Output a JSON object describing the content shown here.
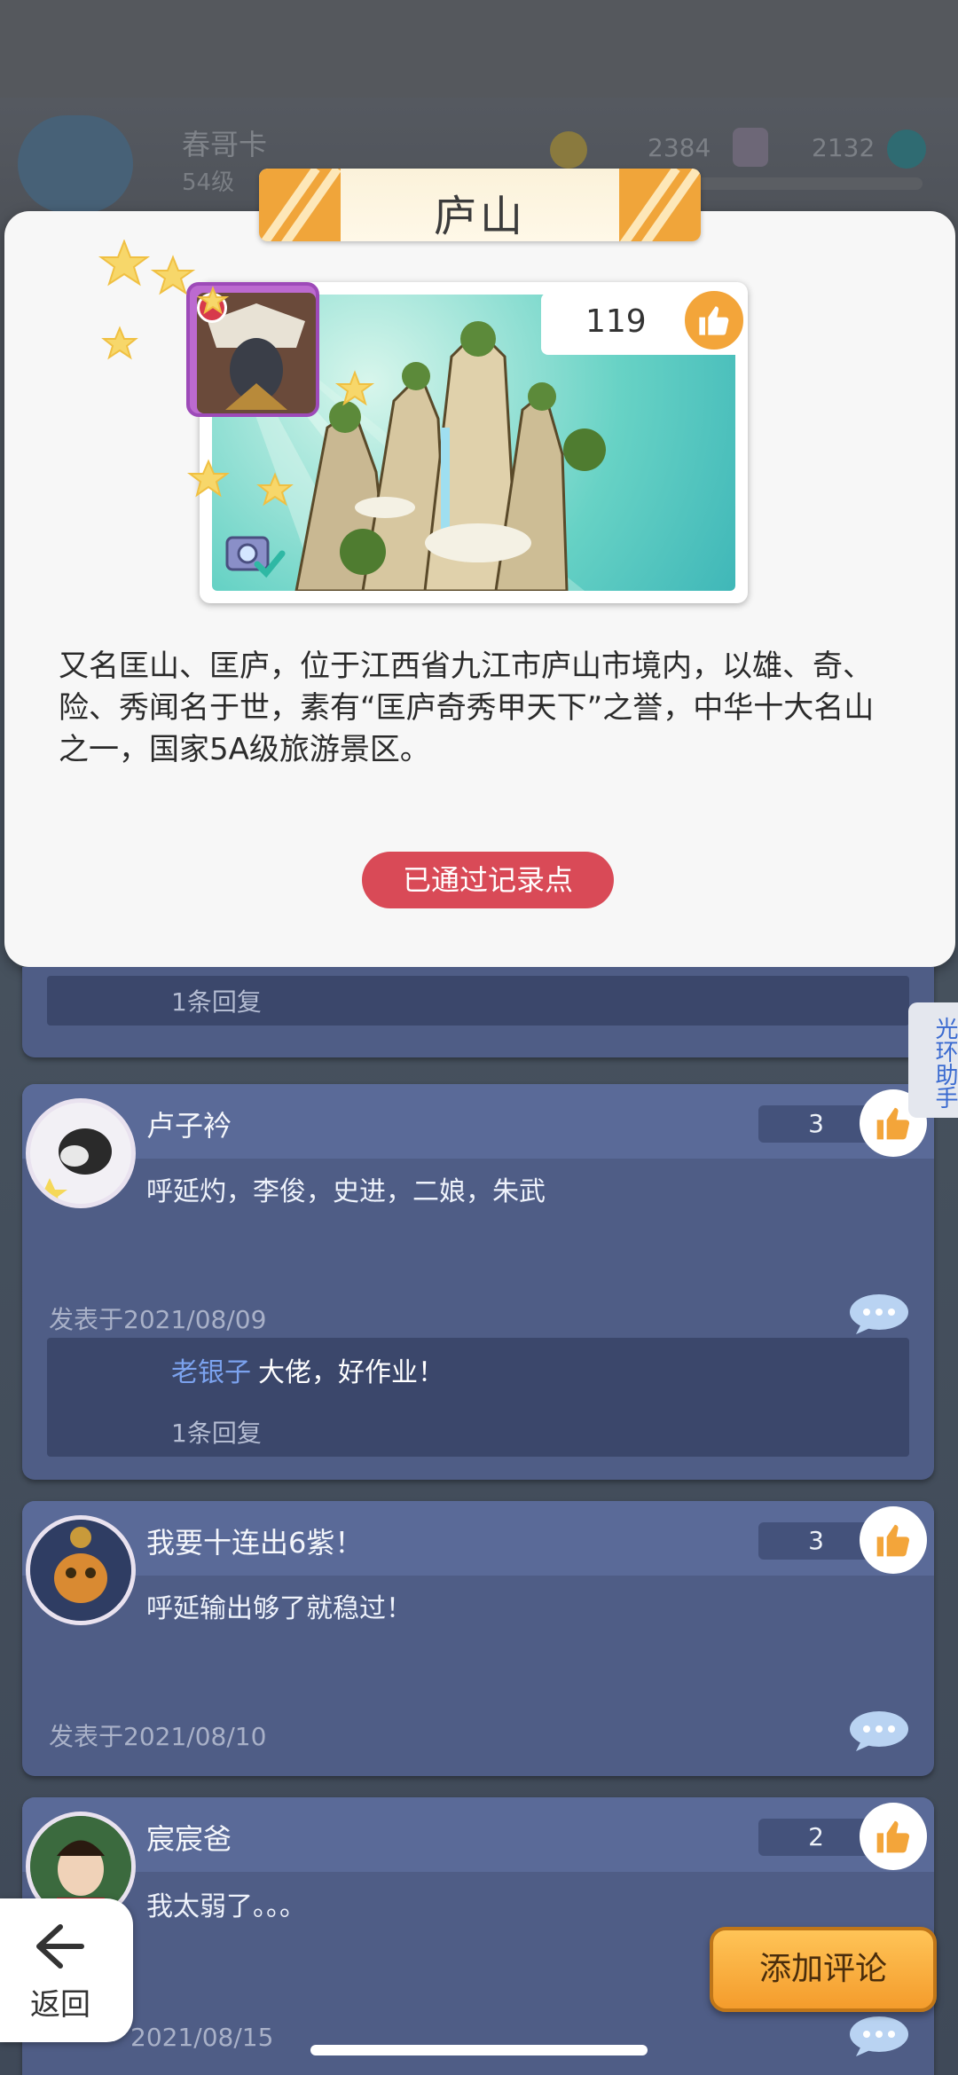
{
  "background": {
    "player_name": "春哥卡",
    "player_level": "54级",
    "value1": "2384",
    "value2": "2132"
  },
  "detail": {
    "title": "庐山",
    "like_count": "119",
    "description": "又名匡山、匡庐，位于江西省九江市庐山市境内，以雄、奇、险、秀闻名于世，素有“匡庐奇秀甲天下”之誉，中华十大名山之一，国家5A级旅游景区。",
    "status": "已通过记录点"
  },
  "helper_tab": "光环助手",
  "comments_partial_top": {
    "reply_count": "1条回复"
  },
  "comments": [
    {
      "username": "卢子衿",
      "likes": "3",
      "text": "呼延灼，李俊，史进，二娘，朱武",
      "date": "发表于2021/08/09",
      "reply_user": "老银子",
      "reply_text": "大佬，好作业！",
      "reply_count": "1条回复"
    },
    {
      "username": "我要十连出6紫！",
      "likes": "3",
      "text": "呼延输出够了就稳过！",
      "date": "发表于2021/08/10"
    },
    {
      "username": "宸宸爸",
      "likes": "2",
      "text": "我太弱了。。。",
      "date": "2021/08/15"
    }
  ],
  "buttons": {
    "back": "返回",
    "add_comment": "添加评论"
  },
  "colors": {
    "accent_orange": "#f3a53a",
    "status_red": "#d94a57",
    "comment_bg": "#4f5d86",
    "reply_user_blue": "#7ba2ee"
  }
}
